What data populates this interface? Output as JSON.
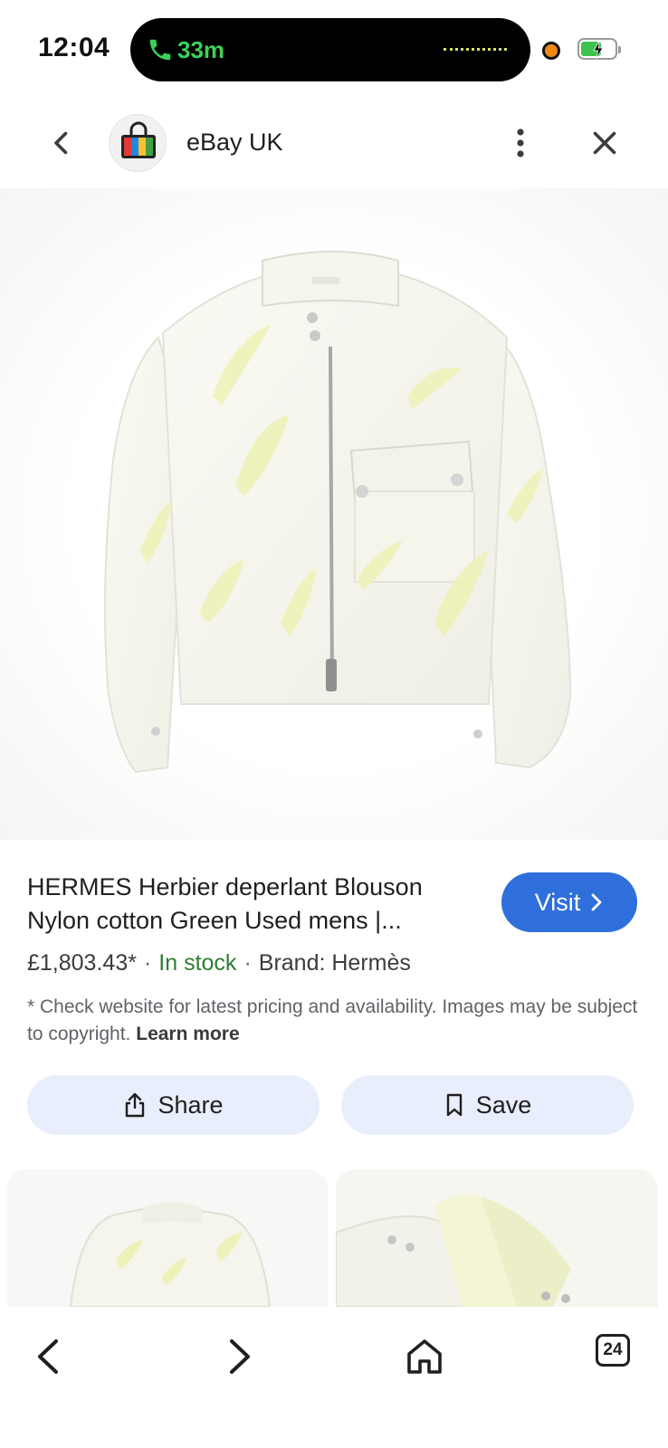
{
  "status_bar": {
    "time": "12:04",
    "call_duration": "33m",
    "battery_level": 0.62,
    "icons": [
      "phone-call-icon",
      "recording-dot-icon",
      "battery-charging-icon"
    ]
  },
  "header": {
    "site_name": "eBay UK",
    "icons": [
      "back-chevron-icon",
      "shopping-bag-logo-icon",
      "more-vert-icon",
      "close-icon"
    ]
  },
  "product": {
    "title": "HERMES Herbier deperlant Blouson Nylon cotton Green Used mens |...",
    "price": "£1,803.43*",
    "separator": "·",
    "stock": "In stock",
    "brand": "Brand: Hermès",
    "disclaimer": "* Check website for latest pricing and availability. Images may be subject to copyright.",
    "learn_more": "Learn more",
    "stock_color": "#2e7d32"
  },
  "actions": {
    "visit_label": "Visit",
    "share_label": "Share",
    "save_label": "Save",
    "accent": "#2f6fdc",
    "pill_bg": "#e8eefb"
  },
  "bottom_nav": {
    "tab_count": "24",
    "icons": [
      "back-arrow-icon",
      "forward-arrow-icon",
      "home-icon",
      "tabs-icon"
    ]
  }
}
